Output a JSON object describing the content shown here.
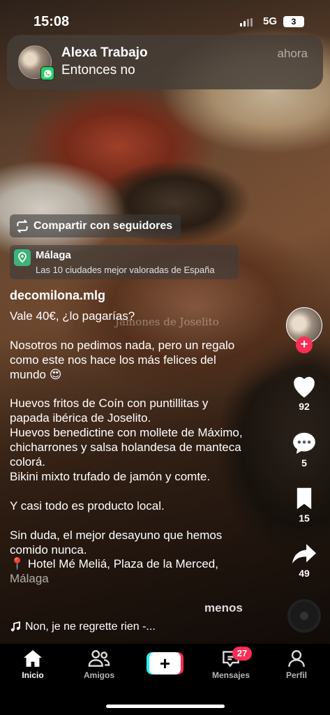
{
  "status_bar": {
    "time": "15:08",
    "network": "5G",
    "battery": "3"
  },
  "notification": {
    "app": "WhatsApp",
    "sender": "Alexa Trabajo",
    "message": "Entonces no",
    "when": "ahora"
  },
  "share_pill": {
    "label": "Compartir con seguidores",
    "icon": "repost-icon"
  },
  "location": {
    "place": "Málaga",
    "subtitle": "Las 10 ciudades mejor valoradas de España",
    "icon": "map-pin-icon"
  },
  "watermark": "Jamones de Joselito",
  "post": {
    "username": "decomilona.mlg",
    "caption_main": "Vale 40€, ¿lo pagarías?\n\nNosotros no pedimos nada, pero un regalo como este nos hace los más felices del mundo 😍\n\nHuevos fritos de Coín con puntillitas y papada ibérica de Joselito.\nHuevos benedictine con mollete de Máximo, chicharrones y salsa holandesa de manteca colorá.\nBikini mixto trufado de jamón y comte.\n\nY casi todo es producto local.\n\nSin duda, el mejor desayuno que hemos comido nunca.\n📍 Hotel Mé Meliá, Plaza de la Merced,",
    "caption_faded": "Málaga",
    "less_label": "menos",
    "music": "Non, je ne regrette rien -..."
  },
  "actions": {
    "likes": "92",
    "comments": "5",
    "saves": "15",
    "shares": "49"
  },
  "nav": {
    "home": "Inicio",
    "friends": "Amigos",
    "create_symbol": "+",
    "inbox": "Mensajes",
    "inbox_badge": "27",
    "profile": "Perfil"
  },
  "colors": {
    "accent": "#fe2c55",
    "cyan": "#25f4ee",
    "whatsapp": "#25d366",
    "location_green": "#3fb37a"
  }
}
